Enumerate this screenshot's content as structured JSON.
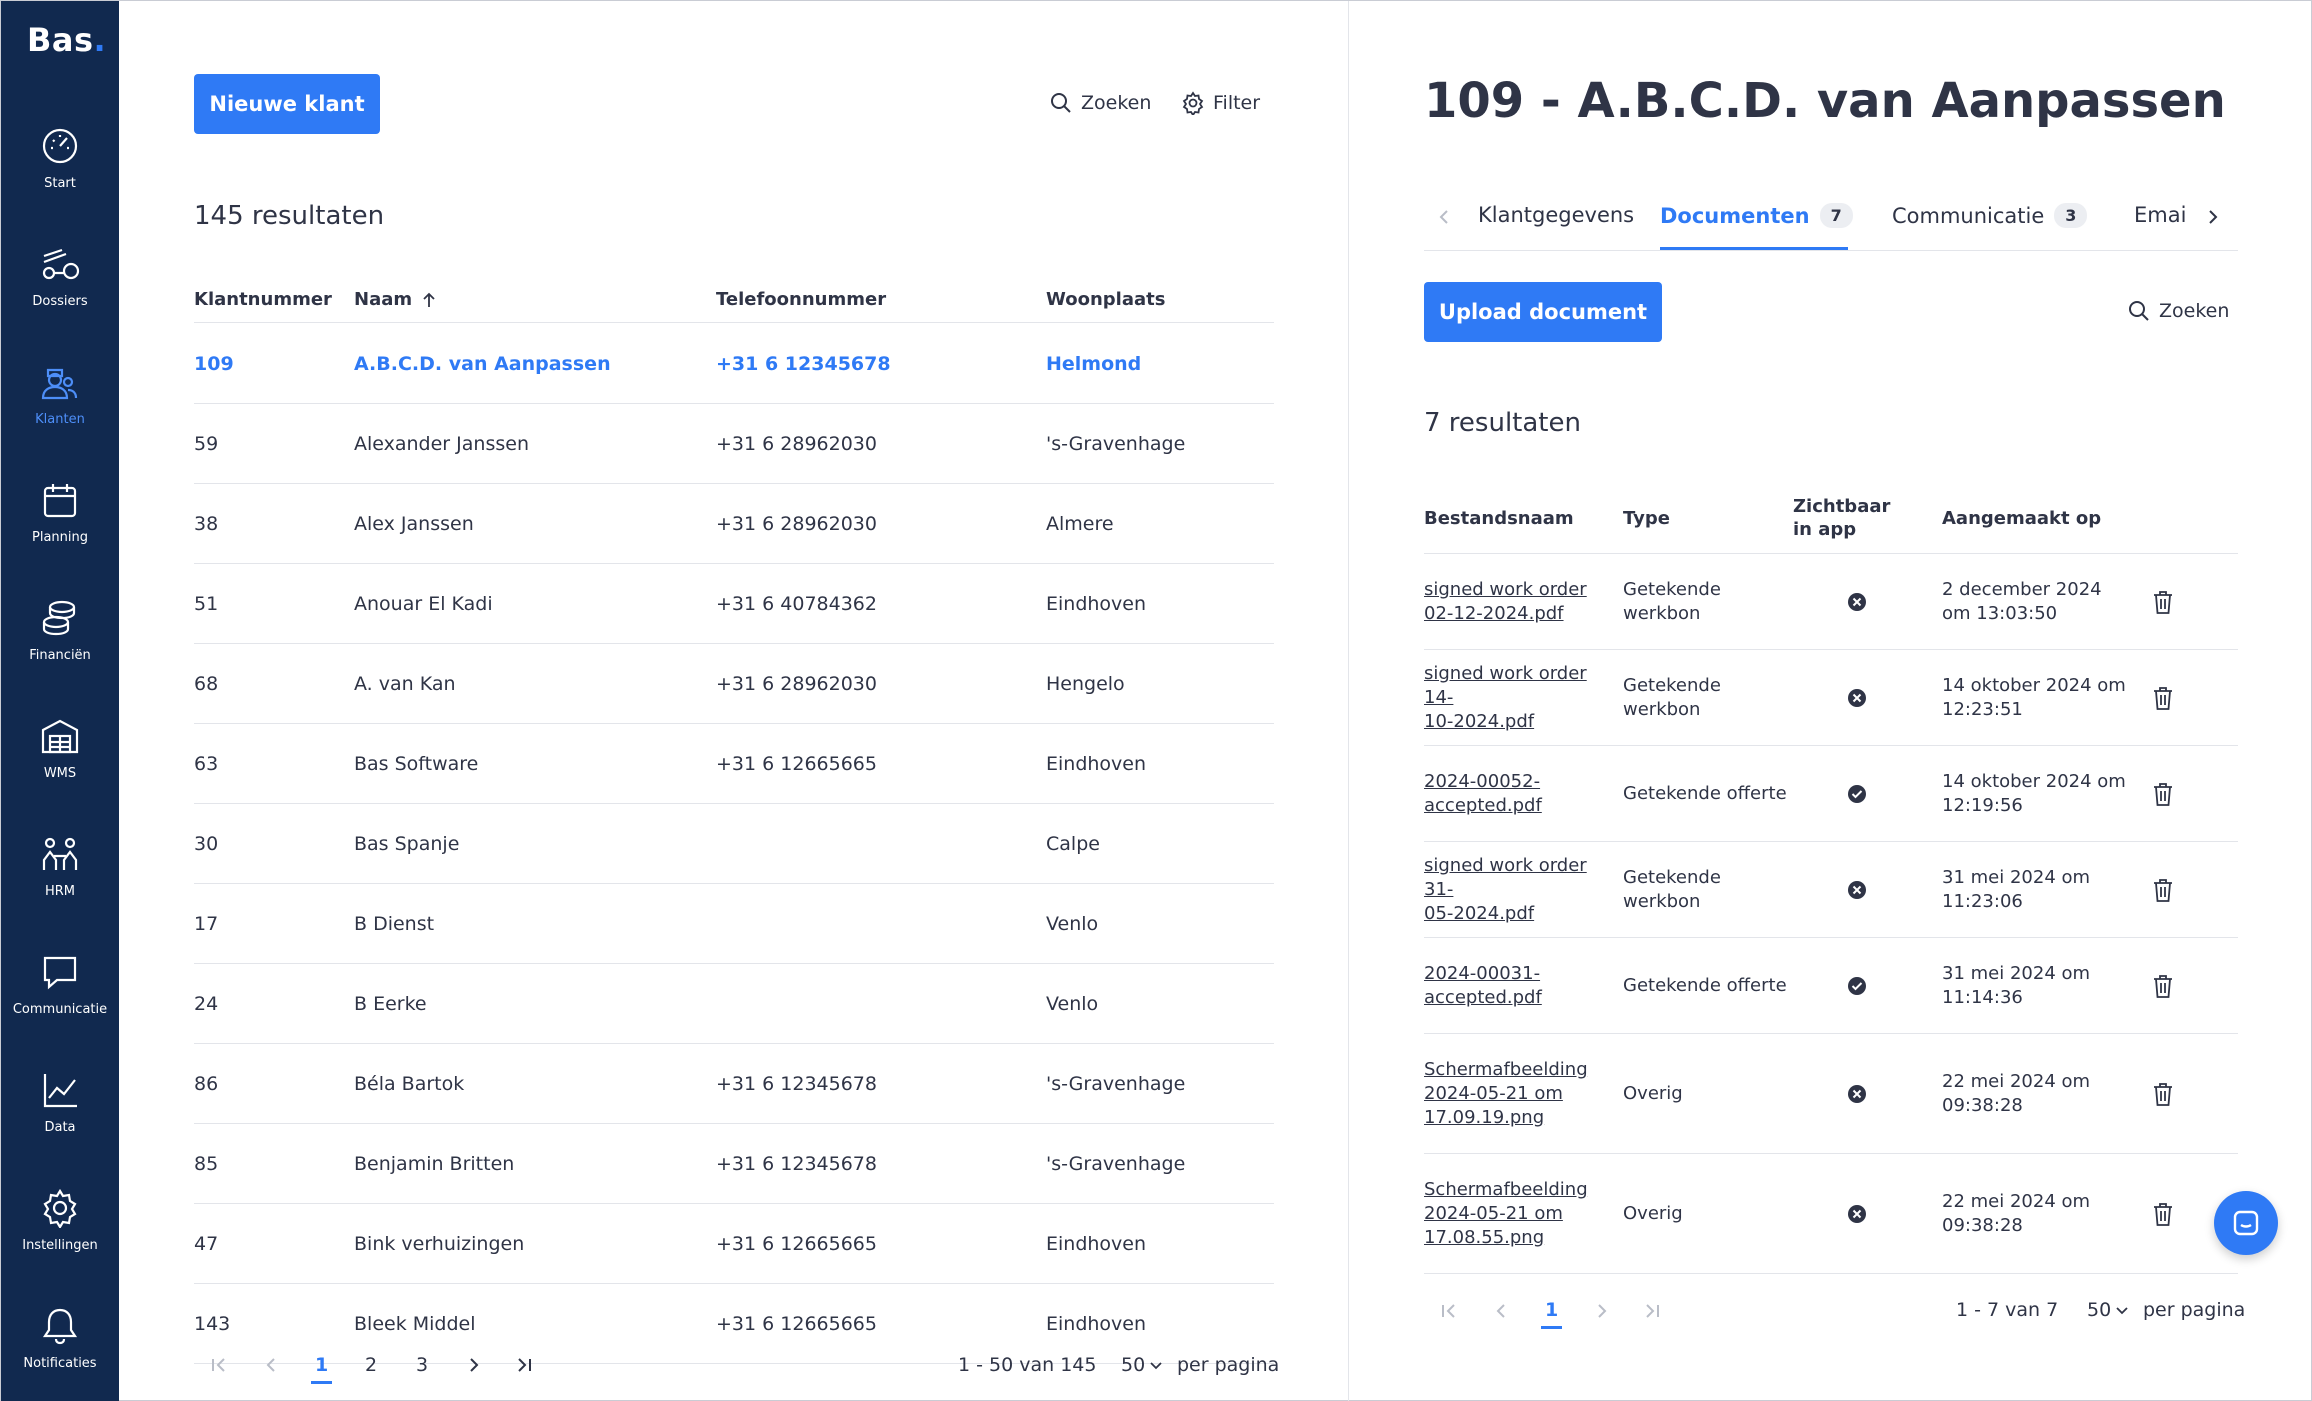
{
  "app": {
    "logo_text": "Bas",
    "logo_dot": "."
  },
  "sidebar": {
    "items": [
      {
        "label": "Start",
        "icon": "gauge-icon",
        "active": false
      },
      {
        "label": "Dossiers",
        "icon": "dossiers-icon",
        "active": false
      },
      {
        "label": "Klanten",
        "icon": "customers-icon",
        "active": true
      },
      {
        "label": "Planning",
        "icon": "calendar-icon",
        "active": false
      },
      {
        "label": "Financiën",
        "icon": "coins-icon",
        "active": false
      },
      {
        "label": "WMS",
        "icon": "warehouse-icon",
        "active": false
      },
      {
        "label": "HRM",
        "icon": "people-icon",
        "active": false
      },
      {
        "label": "Communicatie",
        "icon": "chat-icon",
        "active": false
      },
      {
        "label": "Data",
        "icon": "line-chart-icon",
        "active": false
      },
      {
        "label": "Instellingen",
        "icon": "gear-icon",
        "active": false
      },
      {
        "label": "Notificaties",
        "icon": "bell-icon",
        "active": false
      }
    ]
  },
  "customers": {
    "new_button": "Nieuwe klant",
    "search_label": "Zoeken",
    "filter_label": "Filter",
    "results": "145 resultaten",
    "columns": [
      "Klantnummer",
      "Naam",
      "Telefoonnummer",
      "Woonplaats"
    ],
    "rows": [
      [
        "109",
        "A.B.C.D. van Aanpassen",
        "+31 6 12345678",
        "Helmond"
      ],
      [
        "59",
        "Alexander Janssen",
        "+31 6 28962030",
        "'s-Gravenhage"
      ],
      [
        "38",
        "Alex Janssen",
        "+31 6 28962030",
        "Almere"
      ],
      [
        "51",
        "Anouar El Kadi",
        "+31 6 40784362",
        "Eindhoven"
      ],
      [
        "68",
        "A. van Kan",
        "+31 6 28962030",
        "Hengelo"
      ],
      [
        "63",
        "Bas Software",
        "+31 6 12665665",
        "Eindhoven"
      ],
      [
        "30",
        "Bas Spanje",
        "",
        "Calpe"
      ],
      [
        "17",
        "B Dienst",
        "",
        "Venlo"
      ],
      [
        "24",
        "B Eerke",
        "",
        "Venlo"
      ],
      [
        "86",
        "Béla Bartok",
        "+31 6 12345678",
        "'s-Gravenhage"
      ],
      [
        "85",
        "Benjamin Britten",
        "+31 6 12345678",
        "'s-Gravenhage"
      ],
      [
        "47",
        "Bink verhuizingen",
        "+31 6 12665665",
        "Eindhoven"
      ],
      [
        "143",
        "Bleek Middel",
        "+31 6 12665665",
        "Eindhoven"
      ]
    ],
    "pager": {
      "pages": [
        "1",
        "2",
        "3"
      ],
      "range": "1 - 50 van 145",
      "per_page": "50",
      "per_page_label": "per pagina"
    }
  },
  "detail": {
    "title": "109 - A.B.C.D. van Aanpassen",
    "tabs": [
      {
        "label": "Klantgegevens",
        "count": ""
      },
      {
        "label": "Documenten",
        "count": "7"
      },
      {
        "label": "Communicatie",
        "count": "3"
      },
      {
        "label": "Emai",
        "count": ""
      }
    ],
    "upload_button": "Upload document",
    "search_label": "Zoeken",
    "results": "7 resultaten",
    "columns": [
      "Bestandsnaam",
      "Type",
      "Zichtbaar in app",
      "Aangemaakt op"
    ],
    "documents": [
      {
        "name": [
          "signed work order",
          "02-12-2024.pdf"
        ],
        "type": [
          "Getekende",
          "werkbon"
        ],
        "visible": false,
        "created": [
          "2 december 2024",
          "om 13:03:50"
        ]
      },
      {
        "name": [
          "signed work order 14-",
          "10-2024.pdf"
        ],
        "type": [
          "Getekende",
          "werkbon"
        ],
        "visible": false,
        "created": [
          "14 oktober 2024 om",
          "12:23:51"
        ]
      },
      {
        "name": [
          "2024-00052-",
          "accepted.pdf"
        ],
        "type": [
          "Getekende offerte"
        ],
        "visible": true,
        "created": [
          "14 oktober 2024 om",
          "12:19:56"
        ]
      },
      {
        "name": [
          "signed work order 31-",
          "05-2024.pdf"
        ],
        "type": [
          "Getekende",
          "werkbon"
        ],
        "visible": false,
        "created": [
          "31 mei 2024 om",
          "11:23:06"
        ]
      },
      {
        "name": [
          "2024-00031-",
          "accepted.pdf"
        ],
        "type": [
          "Getekende offerte"
        ],
        "visible": true,
        "created": [
          "31 mei 2024 om",
          "11:14:36"
        ]
      },
      {
        "name": [
          "Schermafbeelding",
          "2024-05-21 om",
          "17.09.19.png"
        ],
        "type": [
          "Overig"
        ],
        "visible": false,
        "created": [
          "22 mei 2024 om",
          "09:38:28"
        ]
      },
      {
        "name": [
          "Schermafbeelding",
          "2024-05-21 om",
          "17.08.55.png"
        ],
        "type": [
          "Overig"
        ],
        "visible": false,
        "created": [
          "22 mei 2024 om",
          "09:38:28"
        ]
      }
    ],
    "pager": {
      "pages": [
        "1"
      ],
      "range": "1 - 7 van 7",
      "per_page": "50",
      "per_page_label": "per pagina"
    }
  },
  "colors": {
    "sidebar_bg": "#11294f",
    "accent": "#2f7af5",
    "text": "#2f3446"
  }
}
